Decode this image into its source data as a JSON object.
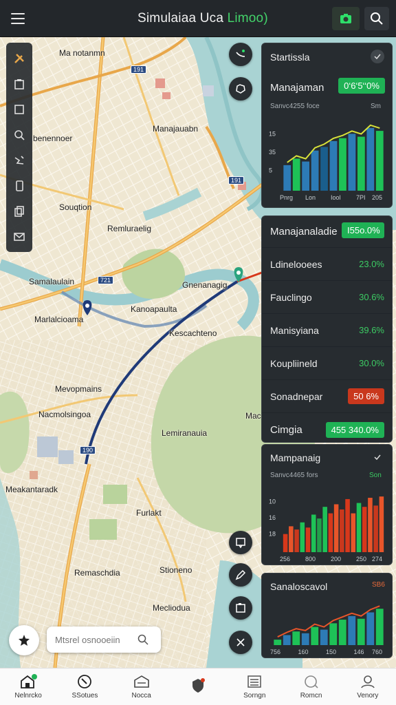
{
  "header": {
    "title_main": "Simulaiaa Uca ",
    "title_accent": "Limoo)"
  },
  "map": {
    "labels": [
      "Ma notanmn",
      "benennoer",
      "Manajauabn",
      "Souqtion",
      "Remluraelig",
      "Samalaulain",
      "Marlalcioama",
      "Kanoapaulta",
      "Gnenanagig",
      "Kescachteno",
      "Mevopmains",
      "Nacmolsingoa",
      "Lemiranauia",
      "Mac",
      "Meakantaradk",
      "Furlakt",
      "Remaschdia",
      "Stioneno",
      "Mecliodua"
    ],
    "shields": [
      "191",
      "191",
      "721",
      "190"
    ]
  },
  "panels": {
    "stats1": {
      "title": "Startissla",
      "metric_label": "Manajaman",
      "metric_value": "0‘6‘5‘‘0%",
      "subtitle": "Sanvc4255 foce",
      "legend": "Sm",
      "yticks": [
        "15",
        "35",
        "5"
      ],
      "xticks": [
        "Pnrg",
        "Lon",
        "Iool",
        "7PI",
        "205"
      ]
    },
    "list": {
      "title": "Manajanaladie",
      "title_value": "I55o.0%",
      "rows": [
        {
          "label": "Ldinelooees",
          "value": "23.0%",
          "color": "#3ccb63"
        },
        {
          "label": "Fauclingo",
          "value": "30.6%",
          "color": "#3ccb63"
        },
        {
          "label": "Manisyiana",
          "value": "39.6%",
          "color": "#3ccb63"
        },
        {
          "label": "Koupliineld",
          "value": "30.0%",
          "color": "#3ccb63"
        },
        {
          "label": "Sonadnepar",
          "value": "50 6%",
          "color": "#ffffff"
        },
        {
          "label": "Cimgia",
          "value": "455 340.0%",
          "color": "#ffffff"
        }
      ]
    },
    "stats2": {
      "title": "Mampanaig",
      "subtitle": "Sanvc4465 fors",
      "legend": "Son",
      "yticks": [
        "10",
        "16",
        "18"
      ],
      "xticks": [
        "256",
        "800",
        "200",
        "250",
        "274"
      ]
    },
    "stats3": {
      "title": "Sanaloscavol",
      "legend": "SB6",
      "xticks": [
        "756",
        "160",
        "150",
        "146",
        "760"
      ]
    }
  },
  "chart_data": [
    {
      "type": "bar",
      "title": "Startissla",
      "categories": [
        "Pnrg",
        "Lon",
        "Iool",
        "7PI",
        "205"
      ],
      "series": [
        {
          "values": [
            35,
            44,
            40,
            55,
            60,
            68,
            72,
            78,
            74,
            86,
            82
          ]
        }
      ],
      "ylim": [
        0,
        100
      ]
    },
    {
      "type": "bar",
      "title": "Mampanaig",
      "categories": [
        "256",
        "800",
        "200",
        "250",
        "274"
      ],
      "series": [
        {
          "values": [
            28,
            40,
            35,
            46,
            38,
            58,
            52,
            70,
            60,
            74,
            66,
            82,
            60,
            76,
            70,
            84,
            72,
            86
          ]
        }
      ],
      "ylim": [
        0,
        100
      ]
    },
    {
      "type": "bar",
      "title": "Sanaloscavol",
      "categories": [
        "756",
        "160",
        "150",
        "146",
        "760"
      ],
      "series": [
        {
          "values": [
            12,
            22,
            30,
            26,
            40,
            34,
            48,
            56,
            64,
            58,
            72,
            80
          ]
        }
      ],
      "ylim": [
        0,
        100
      ]
    }
  ],
  "search": {
    "placeholder": "Mtsrel osnooeiin"
  },
  "nav": [
    {
      "label": "Nelnrcko",
      "icon": "home-icon"
    },
    {
      "label": "SSotues",
      "icon": "compass-icon"
    },
    {
      "label": "Nocca",
      "icon": "inbox-icon"
    },
    {
      "label": "",
      "icon": "shield-icon"
    },
    {
      "label": "Sorngn",
      "icon": "list-icon"
    },
    {
      "label": "Romcn",
      "icon": "chat-icon"
    },
    {
      "label": "Venory",
      "icon": "profile-icon"
    }
  ],
  "colors": {
    "accent": "#43d36a",
    "route": "#1f3a78",
    "panel": "#272c30",
    "red": "#d7381b",
    "green": "#1ec257",
    "blue": "#2d7bb6"
  }
}
